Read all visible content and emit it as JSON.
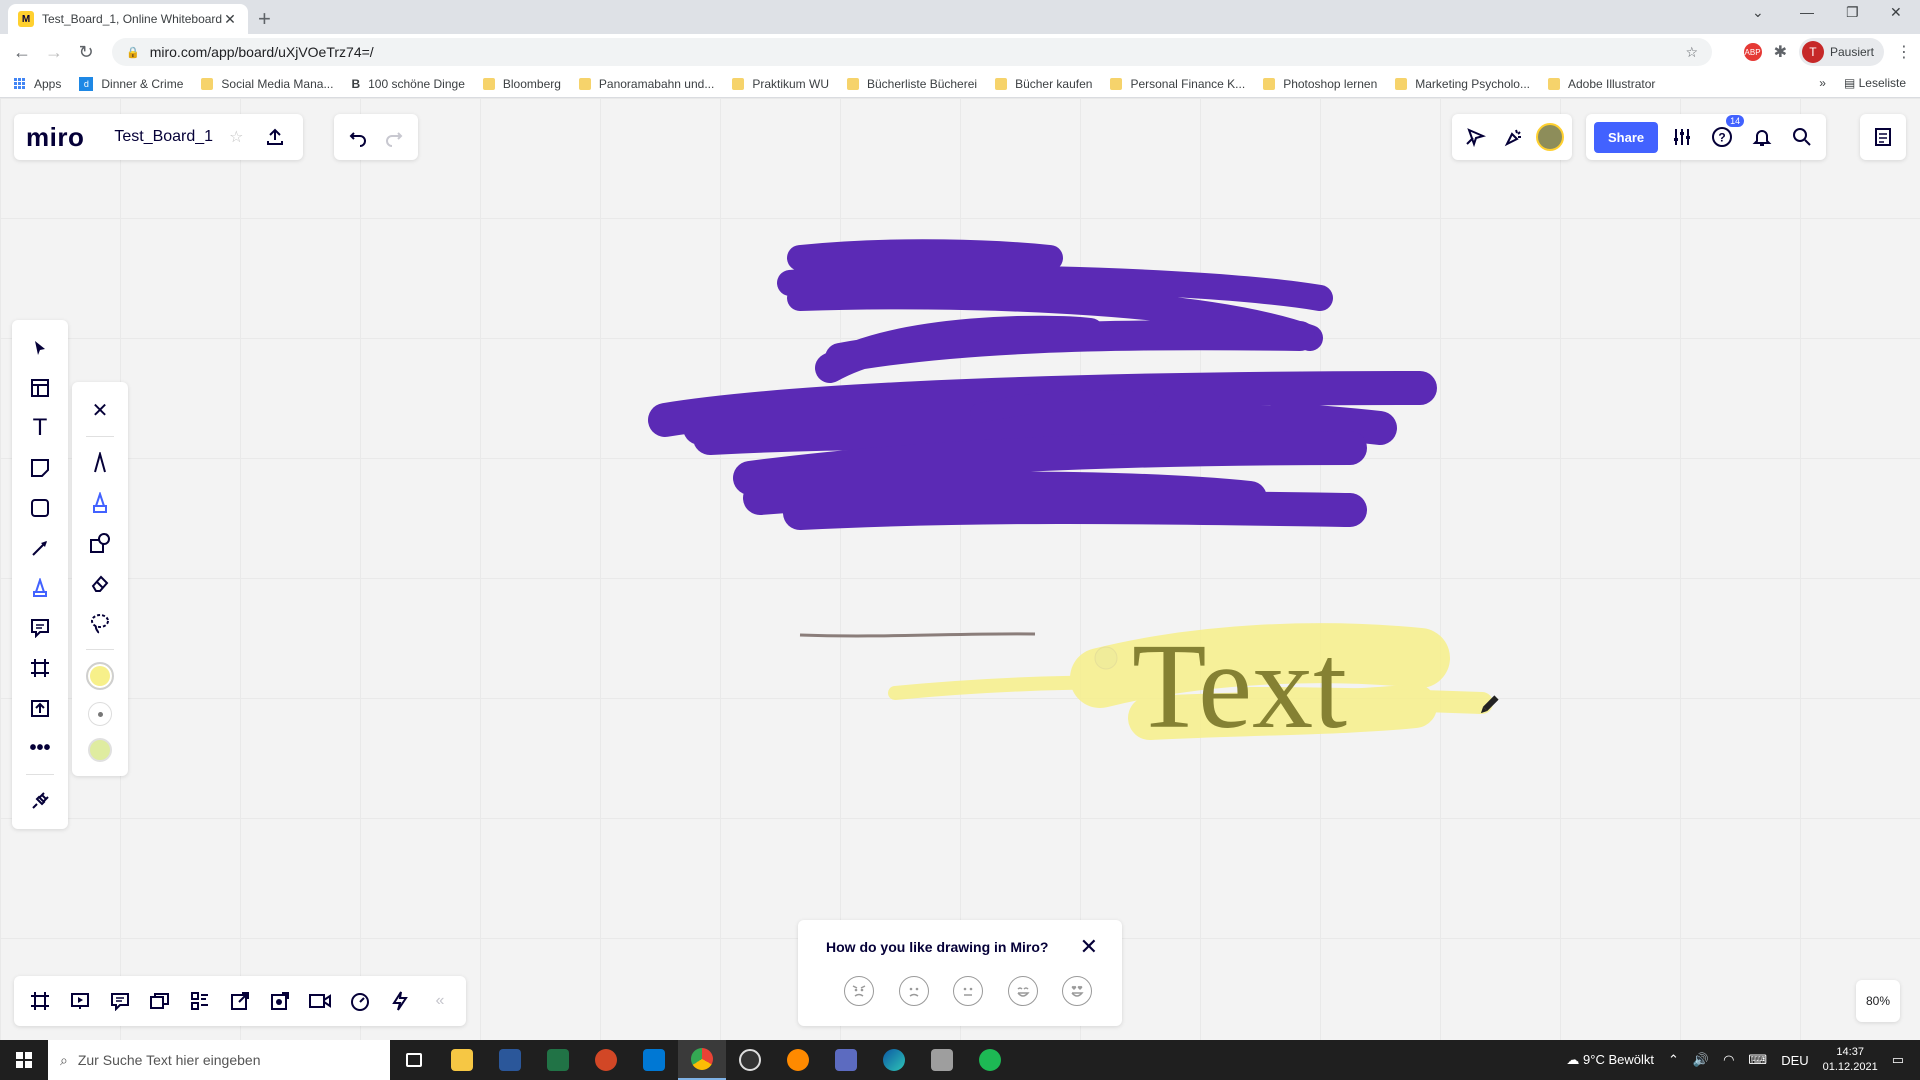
{
  "browser": {
    "tab_title": "Test_Board_1, Online Whiteboard",
    "url": "miro.com/app/board/uXjVOeTrz74=/",
    "profile_label": "Pausiert",
    "profile_initial": "T",
    "abp_label": "ABP"
  },
  "bookmarks": {
    "apps_label": "Apps",
    "items": [
      "Dinner & Crime",
      "Social Media Mana...",
      "100 schöne Dinge",
      "Bloomberg",
      "Panoramabahn und...",
      "Praktikum WU",
      "Bücherliste Bücherei",
      "Bücher kaufen",
      "Personal Finance K...",
      "Photoshop lernen",
      "Marketing Psycholo...",
      "Adobe Illustrator"
    ],
    "more_label": "»",
    "reading_list_label": "Leseliste"
  },
  "miro": {
    "logo": "miro",
    "board_name": "Test_Board_1",
    "share_label": "Share",
    "notification_count": "14",
    "zoom": "80%",
    "canvas_text": "Text",
    "feedback": {
      "question": "How do you like drawing in Miro?"
    },
    "colors": {
      "accent": "#4262ff",
      "marker_purple": "#5b2ab5",
      "highlighter_yellow": "#f7f08a",
      "text_olive": "#858133"
    }
  },
  "taskbar": {
    "search_placeholder": "Zur Suche Text hier eingeben",
    "weather": "9°C Bewölkt",
    "language": "DEU",
    "time": "14:37",
    "date": "01.12.2021"
  }
}
